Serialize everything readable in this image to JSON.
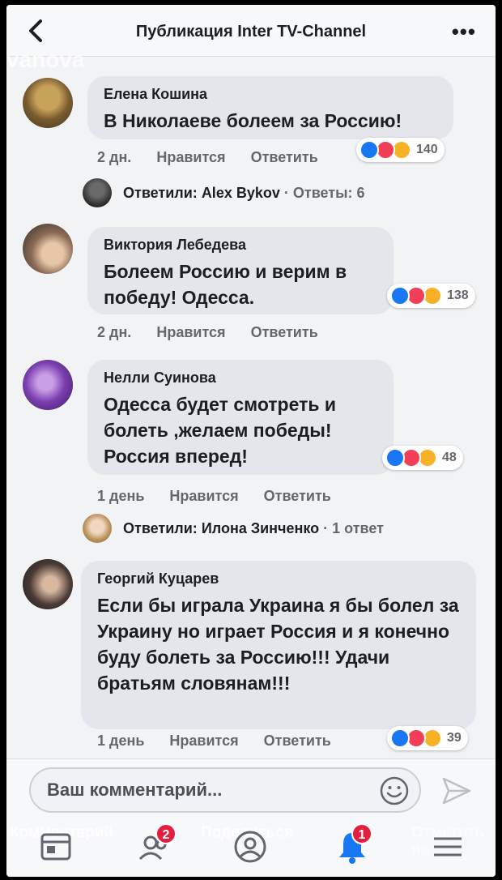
{
  "header": {
    "title": "Публикация Inter TV-Channel",
    "watermark": "vanova"
  },
  "comments": [
    {
      "author": "Елена Кошина",
      "text": "В Николаеве болеем за Россию!",
      "time": "2 дн.",
      "like_label": "Нравится",
      "reply_label": "Ответить",
      "reactions_count": "140",
      "replies": {
        "prefix": "Ответили:",
        "name": "Alex Bykov",
        "count": "· Ответы: 6"
      }
    },
    {
      "author": "Виктория Лебедева",
      "text": "Болеем Россию и верим в победу!   Одесса.",
      "time": "2 дн.",
      "like_label": "Нравится",
      "reply_label": "Ответить",
      "reactions_count": "138"
    },
    {
      "author": "Нелли Суинова",
      "text": "Одесса будет смотреть и болеть ,желаем победы! Россия вперед!",
      "time": "1 день",
      "like_label": "Нравится",
      "reply_label": "Ответить",
      "reactions_count": "48",
      "replies": {
        "prefix": "Ответили:",
        "name": "Илона Зинченко",
        "count": "· 1 ответ"
      }
    },
    {
      "author": "Георгий Куцарев",
      "text": "Если бы играла Украина я бы болел за Украину но играет Россия и я конечно буду болеть за Россию!!! Удачи братьям словянам!!!",
      "time": "1 день",
      "like_label": "Нравится",
      "reply_label": "Ответить",
      "reactions_count": "39"
    }
  ],
  "input": {
    "placeholder": "Ваш комментарий..."
  },
  "ghost_labels": {
    "comment": "Комментарий",
    "share": "Поделиться",
    "mark": "Отметить на"
  },
  "nav": {
    "friends_badge": "2",
    "notifications_badge": "1"
  },
  "colors": {
    "like": "#1877f2",
    "love": "#f33e58",
    "angry": "#f7b125",
    "badge": "#e41e3f"
  }
}
